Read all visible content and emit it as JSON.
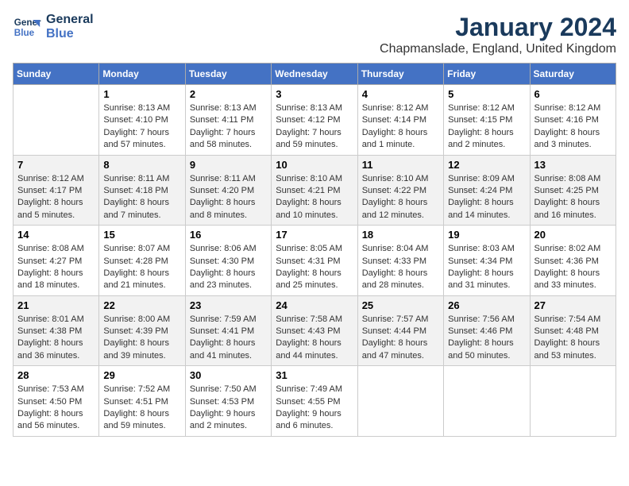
{
  "header": {
    "logo_line1": "General",
    "logo_line2": "Blue",
    "title": "January 2024",
    "subtitle": "Chapmanslade, England, United Kingdom"
  },
  "weekdays": [
    "Sunday",
    "Monday",
    "Tuesday",
    "Wednesday",
    "Thursday",
    "Friday",
    "Saturday"
  ],
  "weeks": [
    [
      {
        "day": "",
        "info": ""
      },
      {
        "day": "1",
        "info": "Sunrise: 8:13 AM\nSunset: 4:10 PM\nDaylight: 7 hours\nand 57 minutes."
      },
      {
        "day": "2",
        "info": "Sunrise: 8:13 AM\nSunset: 4:11 PM\nDaylight: 7 hours\nand 58 minutes."
      },
      {
        "day": "3",
        "info": "Sunrise: 8:13 AM\nSunset: 4:12 PM\nDaylight: 7 hours\nand 59 minutes."
      },
      {
        "day": "4",
        "info": "Sunrise: 8:12 AM\nSunset: 4:14 PM\nDaylight: 8 hours\nand 1 minute."
      },
      {
        "day": "5",
        "info": "Sunrise: 8:12 AM\nSunset: 4:15 PM\nDaylight: 8 hours\nand 2 minutes."
      },
      {
        "day": "6",
        "info": "Sunrise: 8:12 AM\nSunset: 4:16 PM\nDaylight: 8 hours\nand 3 minutes."
      }
    ],
    [
      {
        "day": "7",
        "info": "Sunrise: 8:12 AM\nSunset: 4:17 PM\nDaylight: 8 hours\nand 5 minutes."
      },
      {
        "day": "8",
        "info": "Sunrise: 8:11 AM\nSunset: 4:18 PM\nDaylight: 8 hours\nand 7 minutes."
      },
      {
        "day": "9",
        "info": "Sunrise: 8:11 AM\nSunset: 4:20 PM\nDaylight: 8 hours\nand 8 minutes."
      },
      {
        "day": "10",
        "info": "Sunrise: 8:10 AM\nSunset: 4:21 PM\nDaylight: 8 hours\nand 10 minutes."
      },
      {
        "day": "11",
        "info": "Sunrise: 8:10 AM\nSunset: 4:22 PM\nDaylight: 8 hours\nand 12 minutes."
      },
      {
        "day": "12",
        "info": "Sunrise: 8:09 AM\nSunset: 4:24 PM\nDaylight: 8 hours\nand 14 minutes."
      },
      {
        "day": "13",
        "info": "Sunrise: 8:08 AM\nSunset: 4:25 PM\nDaylight: 8 hours\nand 16 minutes."
      }
    ],
    [
      {
        "day": "14",
        "info": "Sunrise: 8:08 AM\nSunset: 4:27 PM\nDaylight: 8 hours\nand 18 minutes."
      },
      {
        "day": "15",
        "info": "Sunrise: 8:07 AM\nSunset: 4:28 PM\nDaylight: 8 hours\nand 21 minutes."
      },
      {
        "day": "16",
        "info": "Sunrise: 8:06 AM\nSunset: 4:30 PM\nDaylight: 8 hours\nand 23 minutes."
      },
      {
        "day": "17",
        "info": "Sunrise: 8:05 AM\nSunset: 4:31 PM\nDaylight: 8 hours\nand 25 minutes."
      },
      {
        "day": "18",
        "info": "Sunrise: 8:04 AM\nSunset: 4:33 PM\nDaylight: 8 hours\nand 28 minutes."
      },
      {
        "day": "19",
        "info": "Sunrise: 8:03 AM\nSunset: 4:34 PM\nDaylight: 8 hours\nand 31 minutes."
      },
      {
        "day": "20",
        "info": "Sunrise: 8:02 AM\nSunset: 4:36 PM\nDaylight: 8 hours\nand 33 minutes."
      }
    ],
    [
      {
        "day": "21",
        "info": "Sunrise: 8:01 AM\nSunset: 4:38 PM\nDaylight: 8 hours\nand 36 minutes."
      },
      {
        "day": "22",
        "info": "Sunrise: 8:00 AM\nSunset: 4:39 PM\nDaylight: 8 hours\nand 39 minutes."
      },
      {
        "day": "23",
        "info": "Sunrise: 7:59 AM\nSunset: 4:41 PM\nDaylight: 8 hours\nand 41 minutes."
      },
      {
        "day": "24",
        "info": "Sunrise: 7:58 AM\nSunset: 4:43 PM\nDaylight: 8 hours\nand 44 minutes."
      },
      {
        "day": "25",
        "info": "Sunrise: 7:57 AM\nSunset: 4:44 PM\nDaylight: 8 hours\nand 47 minutes."
      },
      {
        "day": "26",
        "info": "Sunrise: 7:56 AM\nSunset: 4:46 PM\nDaylight: 8 hours\nand 50 minutes."
      },
      {
        "day": "27",
        "info": "Sunrise: 7:54 AM\nSunset: 4:48 PM\nDaylight: 8 hours\nand 53 minutes."
      }
    ],
    [
      {
        "day": "28",
        "info": "Sunrise: 7:53 AM\nSunset: 4:50 PM\nDaylight: 8 hours\nand 56 minutes."
      },
      {
        "day": "29",
        "info": "Sunrise: 7:52 AM\nSunset: 4:51 PM\nDaylight: 8 hours\nand 59 minutes."
      },
      {
        "day": "30",
        "info": "Sunrise: 7:50 AM\nSunset: 4:53 PM\nDaylight: 9 hours\nand 2 minutes."
      },
      {
        "day": "31",
        "info": "Sunrise: 7:49 AM\nSunset: 4:55 PM\nDaylight: 9 hours\nand 6 minutes."
      },
      {
        "day": "",
        "info": ""
      },
      {
        "day": "",
        "info": ""
      },
      {
        "day": "",
        "info": ""
      }
    ]
  ]
}
